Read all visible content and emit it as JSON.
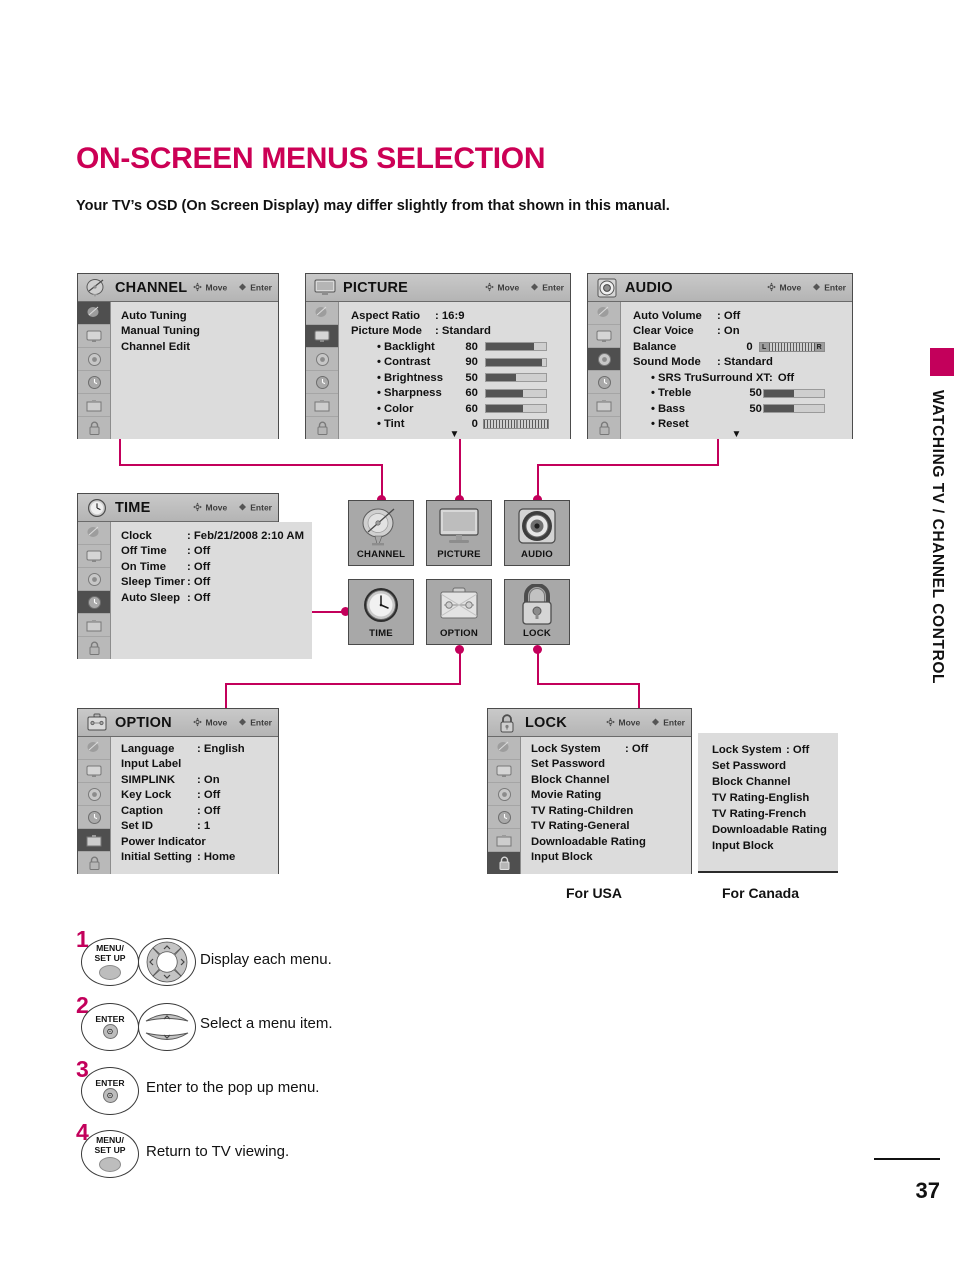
{
  "page": {
    "title": "ON-SCREEN MENUS SELECTION",
    "subtitle": "Your TV’s OSD (On Screen Display) may differ slightly from that shown in this manual.",
    "side_tab_text": "WATCHING TV / CHANNEL CONTROL",
    "page_number": "37",
    "accent_color": "#c3005b"
  },
  "hint": {
    "move": "Move",
    "enter": "Enter"
  },
  "menus": {
    "channel": {
      "title": "CHANNEL",
      "selected_rail": 0,
      "rows": [
        {
          "label": "Auto Tuning",
          "value": ""
        },
        {
          "label": "Manual Tuning",
          "value": ""
        },
        {
          "label": "Channel Edit",
          "value": ""
        }
      ]
    },
    "picture": {
      "title": "PICTURE",
      "selected_rail": 1,
      "rows": [
        {
          "label": "Aspect Ratio",
          "value": ": 16:9"
        },
        {
          "label": "Picture Mode",
          "value": ": Standard"
        }
      ],
      "sliders": [
        {
          "label": "Backlight",
          "value": "80",
          "pct": 80
        },
        {
          "label": "Contrast",
          "value": "90",
          "pct": 90
        },
        {
          "label": "Brightness",
          "value": "50",
          "pct": 50
        },
        {
          "label": "Sharpness",
          "value": "60",
          "pct": 60
        },
        {
          "label": "Color",
          "value": "60",
          "pct": 60
        }
      ],
      "tint": {
        "label": "Tint",
        "value": "0"
      },
      "more": "▼"
    },
    "audio": {
      "title": "AUDIO",
      "selected_rail": 2,
      "rows": [
        {
          "label": "Auto Volume",
          "value": ": Off"
        },
        {
          "label": "Clear Voice",
          "value": ": On"
        }
      ],
      "balance": {
        "label": "Balance",
        "value": "0",
        "left_mark": "L",
        "right_mark": "R"
      },
      "sound_mode": {
        "label": "Sound Mode",
        "value": ": Standard"
      },
      "srs": {
        "label": "SRS TruSurround XT:",
        "value": "Off"
      },
      "sliders": [
        {
          "label": "Treble",
          "value": "50",
          "pct": 50
        },
        {
          "label": "Bass",
          "value": "50",
          "pct": 50
        }
      ],
      "reset": {
        "label": "Reset"
      },
      "more": "▼"
    },
    "time": {
      "title": "TIME",
      "selected_rail": 3,
      "rows": [
        {
          "label": "Clock",
          "value": ": Feb/21/2008  2:10 AM"
        },
        {
          "label": "Off Time",
          "value": ": Off"
        },
        {
          "label": "On Time",
          "value": ": Off"
        },
        {
          "label": "Sleep Timer",
          "value": ": Off"
        },
        {
          "label": "Auto Sleep",
          "value": ": Off"
        }
      ]
    },
    "option": {
      "title": "OPTION",
      "selected_rail": 4,
      "rows": [
        {
          "label": "Language",
          "value": ": English"
        },
        {
          "label": "Input Label",
          "value": ""
        },
        {
          "label": "SIMPLINK",
          "value": ": On"
        },
        {
          "label": "Key Lock",
          "value": ": Off"
        },
        {
          "label": "Caption",
          "value": ": Off"
        },
        {
          "label": "Set ID",
          "value": ": 1"
        },
        {
          "label": "Power Indicator",
          "value": ""
        },
        {
          "label": "Initial Setting",
          "value": ": Home"
        }
      ]
    },
    "lock_usa": {
      "title": "LOCK",
      "selected_rail": 5,
      "caption": "For USA",
      "rows": [
        {
          "label": "Lock System",
          "value": ": Off"
        },
        {
          "label": "Set Password",
          "value": ""
        },
        {
          "label": "Block Channel",
          "value": ""
        },
        {
          "label": "Movie Rating",
          "value": ""
        },
        {
          "label": "TV Rating-Children",
          "value": ""
        },
        {
          "label": "TV Rating-General",
          "value": ""
        },
        {
          "label": "Downloadable Rating",
          "value": ""
        },
        {
          "label": "Input Block",
          "value": ""
        }
      ]
    },
    "lock_canada": {
      "caption": "For Canada",
      "rows": [
        {
          "label": "Lock System",
          "value": ": Off"
        },
        {
          "label": "Set Password",
          "value": ""
        },
        {
          "label": "Block Channel",
          "value": ""
        },
        {
          "label": "TV Rating-English",
          "value": ""
        },
        {
          "label": "TV Rating-French",
          "value": ""
        },
        {
          "label": "Downloadable Rating",
          "value": ""
        },
        {
          "label": "Input Block",
          "value": ""
        }
      ]
    }
  },
  "tiles": [
    {
      "label": "CHANNEL",
      "icon": "satellite-dish-icon"
    },
    {
      "label": "PICTURE",
      "icon": "tv-monitor-icon"
    },
    {
      "label": "AUDIO",
      "icon": "speaker-icon"
    },
    {
      "label": "TIME",
      "icon": "clock-icon"
    },
    {
      "label": "OPTION",
      "icon": "toolbox-icon"
    },
    {
      "label": "LOCK",
      "icon": "padlock-icon"
    }
  ],
  "steps": [
    {
      "num": "1",
      "buttons": [
        "MENU/\nSET UP",
        "nav-pad"
      ],
      "text": "Display each menu."
    },
    {
      "num": "2",
      "buttons": [
        "ENTER",
        "up-down"
      ],
      "text": "Select a menu item."
    },
    {
      "num": "3",
      "buttons": [
        "ENTER"
      ],
      "text": "Enter to the pop up menu."
    },
    {
      "num": "4",
      "buttons": [
        "MENU/\nSET UP"
      ],
      "text": "Return to TV viewing."
    }
  ]
}
